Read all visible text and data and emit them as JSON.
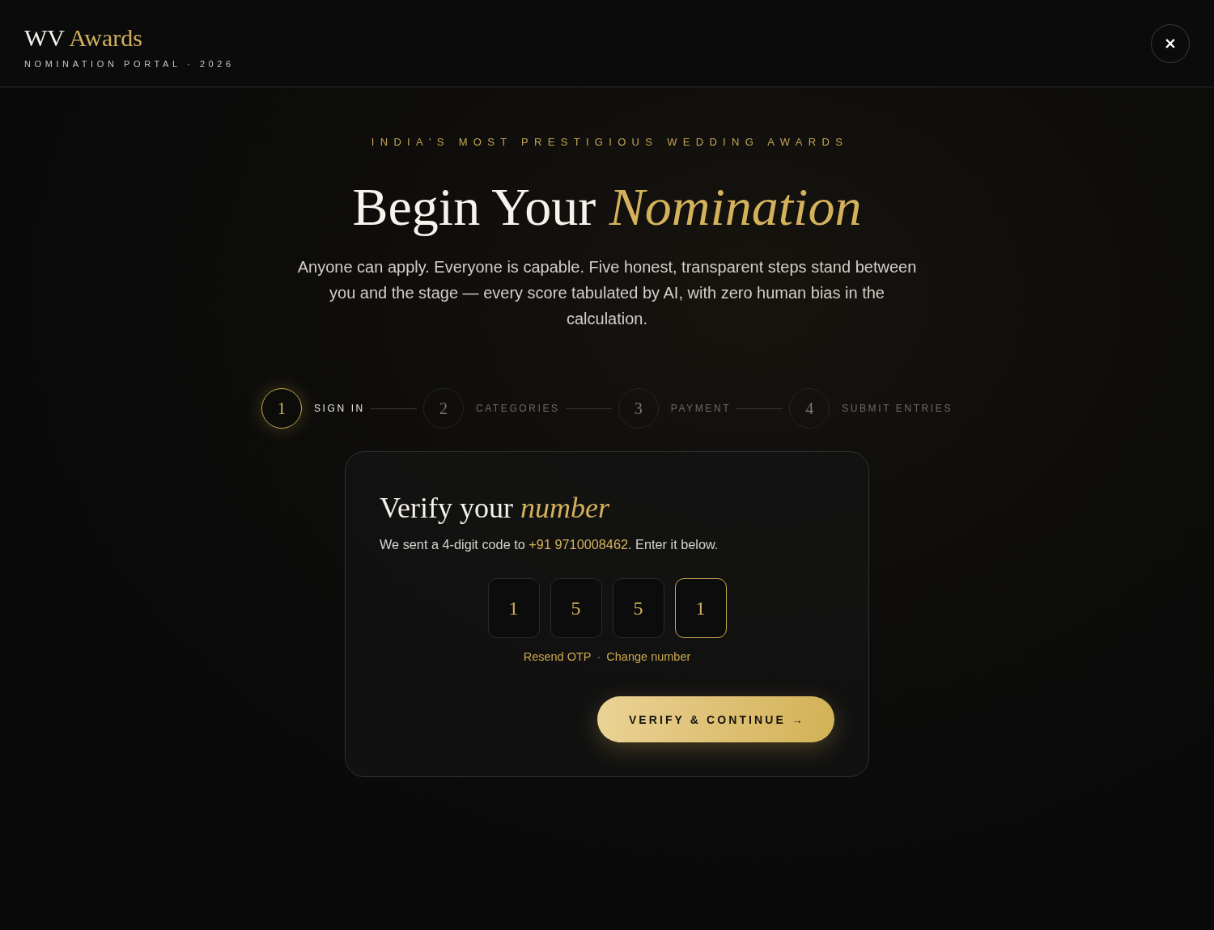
{
  "header": {
    "logo": {
      "primary": "WV",
      "accent": "Awards"
    },
    "subtitle": "NOMINATION PORTAL · 2026",
    "close_button": "×"
  },
  "hero": {
    "tagline": "INDIA'S MOST PRESTIGIOUS WEDDING AWARDS",
    "heading": "Begin Your *Nomination*",
    "intro": "Anyone can apply. Everyone is capable. Five honest, transparent steps stand between you and the stage — every score tabulated by AI, with zero human bias in the calculation."
  },
  "steps": [
    {
      "number": "1",
      "label": "SIGN IN",
      "selected": true
    },
    {
      "number": "2",
      "label": "CATEGORIES",
      "selected": false
    },
    {
      "number": "3",
      "label": "PAYMENT",
      "selected": false
    },
    {
      "number": "4",
      "label": "SUBMIT ENTRIES",
      "selected": false
    }
  ],
  "verify_card": {
    "heading": "Verify your *number*",
    "message": "We sent a 4-digit code to ",
    "phone": "+91 9710008462",
    "message_end": ". Enter it below.",
    "otp": [
      {
        "value": "1",
        "focused": false
      },
      {
        "value": "5",
        "focused": false
      },
      {
        "value": "5",
        "focused": false
      },
      {
        "value": "1",
        "focused": true
      }
    ],
    "links": [
      "Resend OTP",
      "Change number"
    ],
    "separator": "·",
    "button": "VERIFY & CONTINUE →"
  }
}
